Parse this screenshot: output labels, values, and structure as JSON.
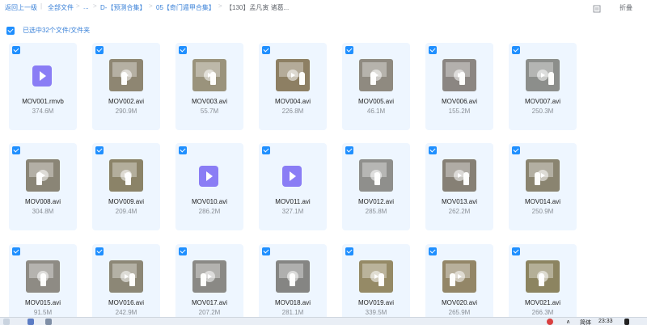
{
  "breadcrumb": {
    "back": "返回上一级",
    "items": [
      "全部文件",
      "...",
      "D-【预测合集】",
      "05【奇门遁甲合集】",
      "【130】孟凡寅 诸葛..."
    ]
  },
  "toolbar": {
    "list_icon": "list-view-icon",
    "collapse_label": "折叠"
  },
  "selection": {
    "label": "已选中32个文件/文件夹"
  },
  "files": [
    {
      "name": "MOV001.rmvb",
      "size": "374.6M",
      "kind": "rmvb",
      "selected": true
    },
    {
      "name": "MOV002.avi",
      "size": "290.9M",
      "kind": "video",
      "tone": "#8e8672",
      "selected": true
    },
    {
      "name": "MOV003.avi",
      "size": "55.7M",
      "kind": "video",
      "tone": "#9a937c",
      "selected": true
    },
    {
      "name": "MOV004.avi",
      "size": "226.8M",
      "kind": "video",
      "tone": "#8d7f63",
      "selected": true
    },
    {
      "name": "MOV005.avi",
      "size": "46.1M",
      "kind": "video",
      "tone": "#8f8a80",
      "selected": true
    },
    {
      "name": "MOV006.avi",
      "size": "155.2M",
      "kind": "video",
      "tone": "#8b8682",
      "selected": true
    },
    {
      "name": "MOV007.avi",
      "size": "250.3M",
      "kind": "video",
      "tone": "#8c8e8b",
      "selected": true
    },
    {
      "name": "MOV008.avi",
      "size": "304.8M",
      "kind": "video",
      "tone": "#8a8576",
      "selected": true
    },
    {
      "name": "MOV009.avi",
      "size": "209.4M",
      "kind": "video",
      "tone": "#8b8368",
      "selected": true
    },
    {
      "name": "MOV010.avi",
      "size": "286.2M",
      "kind": "rmvb",
      "selected": true
    },
    {
      "name": "MOV011.avi",
      "size": "327.1M",
      "kind": "rmvb",
      "selected": true
    },
    {
      "name": "MOV012.avi",
      "size": "285.8M",
      "kind": "video",
      "tone": "#8f8f8c",
      "selected": true
    },
    {
      "name": "MOV013.avi",
      "size": "262.2M",
      "kind": "video",
      "tone": "#868075",
      "selected": true
    },
    {
      "name": "MOV014.avi",
      "size": "250.9M",
      "kind": "video",
      "tone": "#8a8470",
      "selected": true
    },
    {
      "name": "MOV015.avi",
      "size": "91.5M",
      "kind": "video",
      "tone": "#8e8b84",
      "selected": true
    },
    {
      "name": "MOV016.avi",
      "size": "242.9M",
      "kind": "video",
      "tone": "#8c8776",
      "selected": true
    },
    {
      "name": "MOV017.avi",
      "size": "207.2M",
      "kind": "video",
      "tone": "#8a8985",
      "selected": true
    },
    {
      "name": "MOV018.avi",
      "size": "281.1M",
      "kind": "video",
      "tone": "#858583",
      "selected": true
    },
    {
      "name": "MOV019.avi",
      "size": "339.5M",
      "kind": "video",
      "tone": "#958a66",
      "selected": true
    },
    {
      "name": "MOV020.avi",
      "size": "265.9M",
      "kind": "video",
      "tone": "#938667",
      "selected": true
    },
    {
      "name": "MOV021.avi",
      "size": "266.3M",
      "kind": "video",
      "tone": "#8c8460",
      "selected": true
    }
  ],
  "taskbar": {
    "ime": "简体",
    "time": "23:33"
  },
  "colors": {
    "accent": "#1f8fff",
    "card_bg": "#eef6ff",
    "link": "#3b82d8"
  }
}
